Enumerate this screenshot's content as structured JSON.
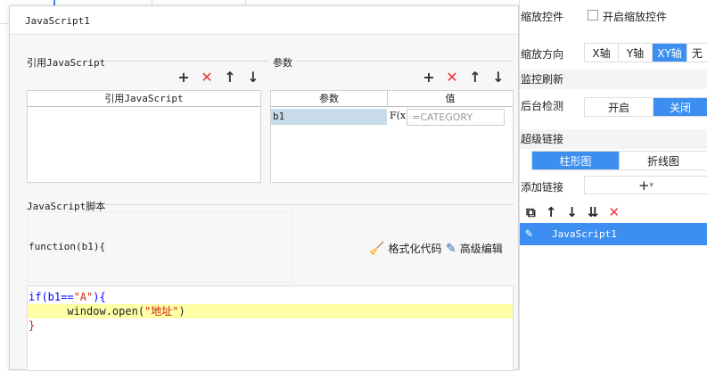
{
  "dialog": {
    "title": "JavaScript1",
    "ref_section_title": "引用JavaScript",
    "ref_header": "引用JavaScript",
    "params_section_title": "参数",
    "params_headers": [
      "参数",
      "值"
    ],
    "param_row": {
      "name": "b1",
      "formula_icon": "F(x)",
      "value_placeholder": "=CATEGORY"
    },
    "script_section_title": "JavaScript脚本",
    "function_signature": "function(b1){",
    "format_code_label": "格式化代码",
    "advanced_edit_label": "高级编辑",
    "code": {
      "line1_kw": "if",
      "line1_mid": "(b1==",
      "line1_str": "\"A\"",
      "line1_end": "){",
      "line2_pre": "      window.open(",
      "line2_str": "\"地址\"",
      "line2_end": ")",
      "line3": "}"
    }
  },
  "right_panel": {
    "zoom_control_label": "缩放控件",
    "enable_zoom_label": "开启缩放控件",
    "zoom_direction_label": "缩放方向",
    "zoom_direction_options": [
      "X轴",
      "Y轴",
      "XY轴",
      "无"
    ],
    "zoom_direction_selected": "XY轴",
    "monitor_refresh_label": "监控刷新",
    "background_detect_label": "后台检测",
    "detect_options": [
      "开启",
      "关闭"
    ],
    "detect_selected": "关闭",
    "hyperlink_label": "超级链接",
    "chart_tabs": [
      "柱形图",
      "折线图"
    ],
    "chart_tab_selected": "柱形图",
    "add_link_label": "添加链接",
    "list_item": "JavaScript1",
    "accent_color": "#3c8ff0"
  }
}
